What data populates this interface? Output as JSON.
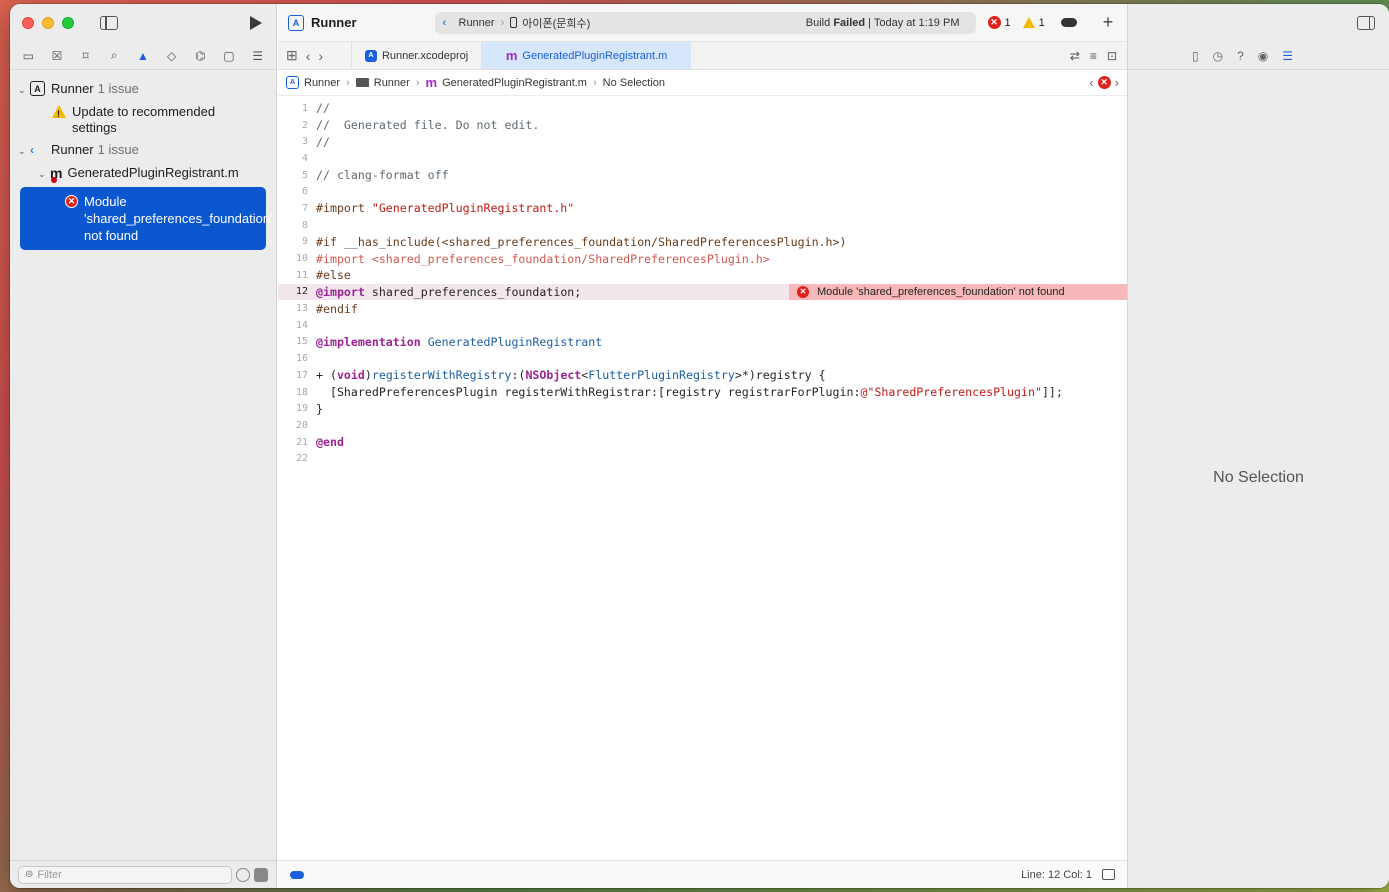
{
  "navigator": {
    "tree": {
      "project1": {
        "name": "Runner",
        "count": "1 issue"
      },
      "warning": {
        "text": "Update to recommended settings"
      },
      "project2": {
        "name": "Runner",
        "count": "1 issue"
      },
      "file": {
        "name": "GeneratedPluginRegistrant.m"
      },
      "selected_issue": {
        "text": "Module 'shared_preferences_foundation' not found"
      }
    },
    "filter_placeholder": "Filter"
  },
  "titlebar": {
    "title": "Runner",
    "scheme": "Runner",
    "device": "아이폰(문희수)",
    "status_prefix": "Build ",
    "status_bold": "Failed",
    "status_suffix": " | Today at 1:19 PM",
    "error_count": "1",
    "warning_count": "1"
  },
  "tabs": [
    {
      "label": "Runner.xcodeproj",
      "active": false
    },
    {
      "label": "GeneratedPluginRegistrant.m",
      "active": true
    }
  ],
  "jump_bar": {
    "project": "Runner",
    "folder": "Runner",
    "file": "GeneratedPluginRegistrant.m",
    "selection": "No Selection"
  },
  "code_lines": [
    "//",
    "//  Generated file. Do not edit.",
    "//",
    "",
    "// clang-format off",
    "",
    "#import \"GeneratedPluginRegistrant.h\"",
    "",
    "#if __has_include(<shared_preferences_foundation/SharedPreferencesPlugin.h>)",
    "#import <shared_preferences_foundation/SharedPreferencesPlugin.h>",
    "#else",
    "@import shared_preferences_foundation;",
    "#endif",
    "",
    "@implementation GeneratedPluginRegistrant",
    "",
    "+ (void)registerWithRegistry:(NSObject<FlutterPluginRegistry>*)registry {",
    "  [SharedPreferencesPlugin registerWithRegistrar:[registry registrarForPlugin:@\"SharedPreferencesPlugin\"]];",
    "}",
    "",
    "@end",
    ""
  ],
  "inline_error": {
    "line": 12,
    "text": "Module 'shared_preferences_foundation' not found"
  },
  "status_bar": {
    "position": "Line: 12  Col: 1"
  },
  "inspector": {
    "empty_text": "No Selection"
  },
  "colors": {
    "accent": "#1a5fe0",
    "error": "#e0221b",
    "warning": "#f5b800"
  }
}
